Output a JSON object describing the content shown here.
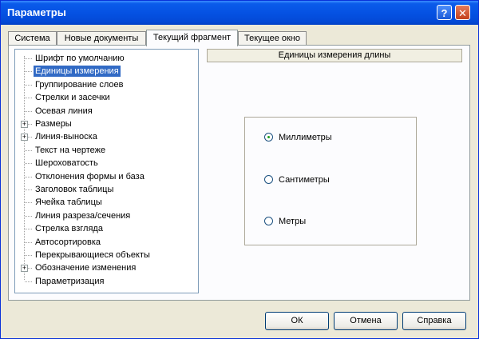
{
  "window": {
    "title": "Параметры"
  },
  "titlebar_buttons": {
    "help": "?",
    "close": "✕"
  },
  "tabs": [
    {
      "label": "Система"
    },
    {
      "label": "Новые документы"
    },
    {
      "label": "Текущий фрагмент",
      "active": true
    },
    {
      "label": "Текущее окно"
    }
  ],
  "tree": {
    "items": [
      {
        "label": "Шрифт по умолчанию"
      },
      {
        "label": "Единицы измерения",
        "selected": true
      },
      {
        "label": "Группирование слоев"
      },
      {
        "label": "Стрелки и засечки"
      },
      {
        "label": "Осевая линия"
      },
      {
        "label": "Размеры",
        "expandable": true
      },
      {
        "label": "Линия-выноска",
        "expandable": true
      },
      {
        "label": "Текст на чертеже"
      },
      {
        "label": "Шероховатость"
      },
      {
        "label": "Отклонения формы и база"
      },
      {
        "label": "Заголовок таблицы"
      },
      {
        "label": "Ячейка таблицы"
      },
      {
        "label": "Линия разреза/сечения"
      },
      {
        "label": "Стрелка взгляда"
      },
      {
        "label": "Автосортировка"
      },
      {
        "label": "Перекрывающиеся объекты"
      },
      {
        "label": "Обозначение изменения",
        "expandable": true
      },
      {
        "label": "Параметризация"
      }
    ],
    "expander_glyph": "+"
  },
  "section_header": "Единицы измерения длины",
  "units": {
    "options": [
      {
        "label": "Миллиметры",
        "checked": true
      },
      {
        "label": "Сантиметры",
        "checked": false
      },
      {
        "label": "Метры",
        "checked": false
      }
    ]
  },
  "buttons": {
    "ok": "ОК",
    "cancel": "Отмена",
    "help": "Справка"
  }
}
